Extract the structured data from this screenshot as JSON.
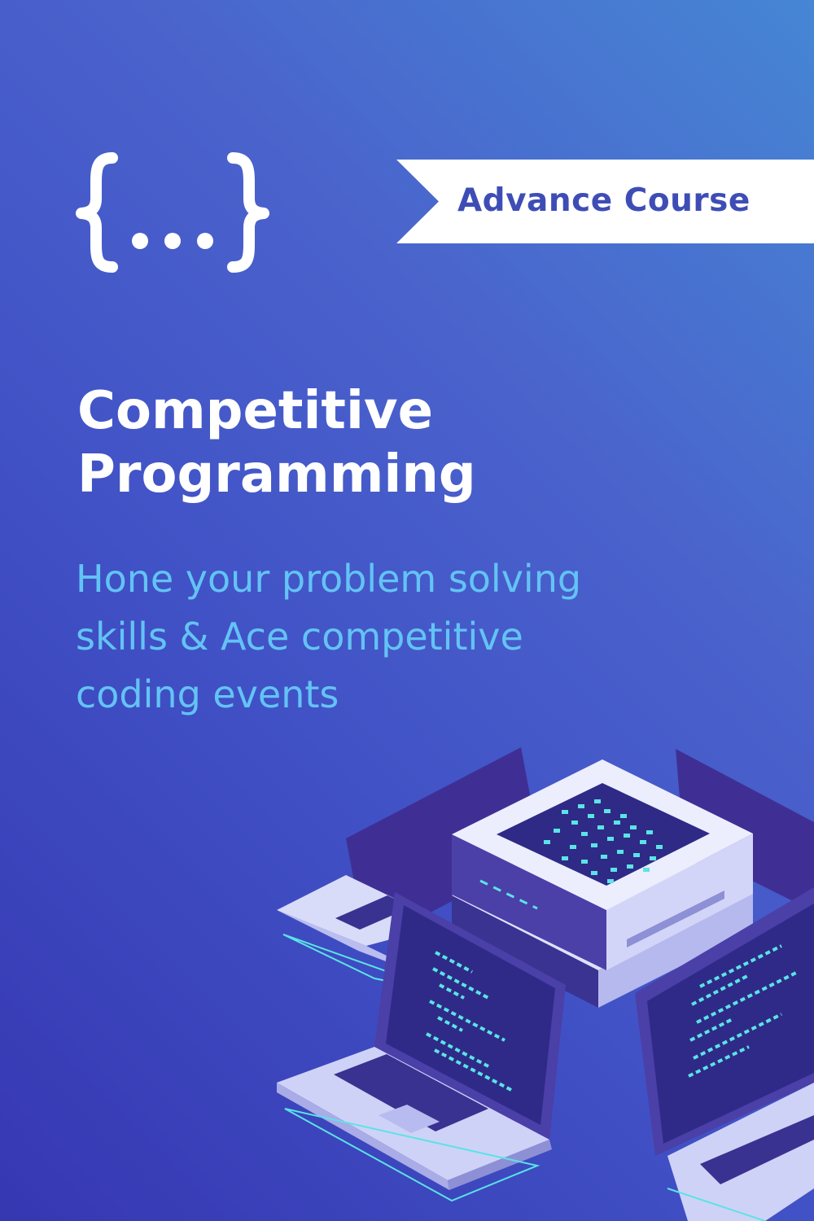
{
  "badge": {
    "label": "Advance Course"
  },
  "course": {
    "title_lines": [
      "Competitive",
      "Programming"
    ],
    "subtitle_lines": [
      "Hone your problem solving",
      "skills & Ace competitive",
      "coding events"
    ]
  },
  "icons": {
    "logo": "curly-braces-ellipsis-icon",
    "illustration": "isometric-server-and-laptops"
  },
  "colors": {
    "background_start": "#4686d4",
    "background_end": "#3637b2",
    "title": "#ffffff",
    "subtitle": "#63c3f5",
    "badge_background": "#ffffff",
    "badge_text": "#3e4db6",
    "code_accent": "#5be3e6"
  }
}
